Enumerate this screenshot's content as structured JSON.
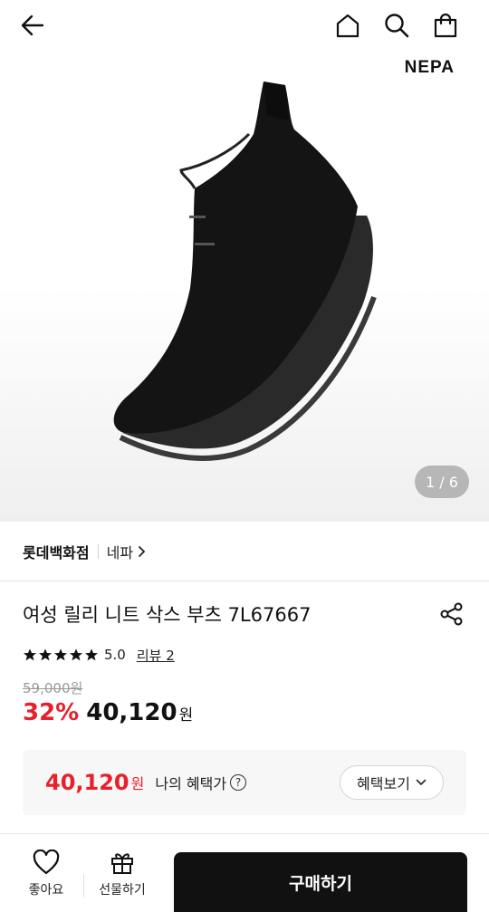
{
  "header": {
    "back_icon": "arrow-left-icon",
    "home_icon": "home-icon",
    "search_icon": "search-icon",
    "bag_icon": "shopping-bag-icon"
  },
  "gallery": {
    "brand_logo": "NEPA",
    "counter": "1 / 6"
  },
  "store": {
    "name": "롯데백화점",
    "brand": "네파"
  },
  "product": {
    "title": "여성 릴리 니트 삭스 부츠 7L67667",
    "rating": "5.0",
    "stars": 5,
    "review_label": "리뷰 2",
    "original_price": "59,000원",
    "discount": "32%",
    "price": "40,120",
    "price_unit": "원"
  },
  "benefit": {
    "price": "40,120",
    "unit": "원",
    "label": "나의 혜택가",
    "help": "?",
    "button_label": "혜택보기"
  },
  "bottom_bar": {
    "like_label": "좋아요",
    "gift_label": "선물하기",
    "buy_label": "구매하기"
  },
  "colors": {
    "accent_red": "#e8202a",
    "buy_button": "#111111"
  }
}
